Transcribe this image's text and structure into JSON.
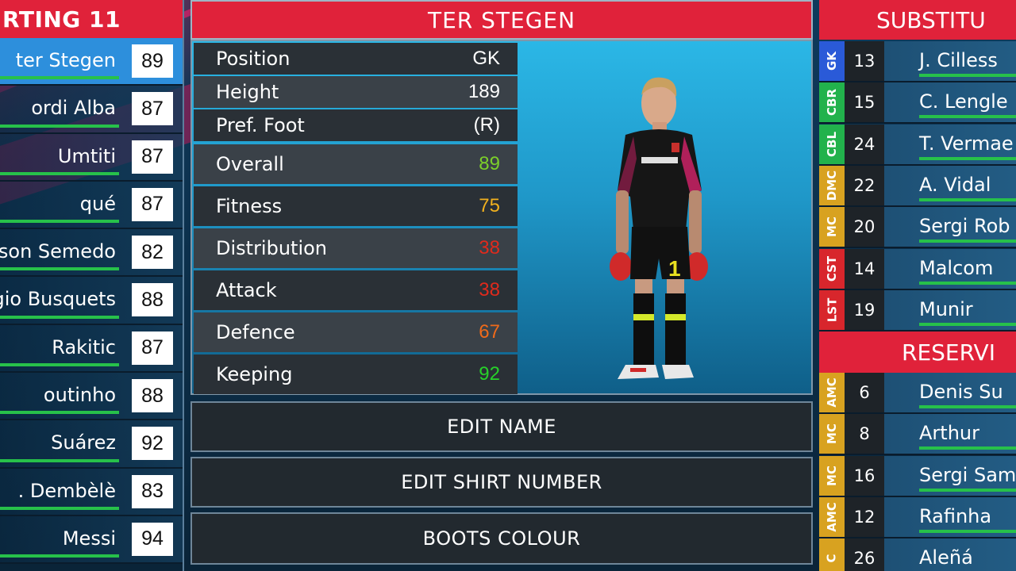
{
  "starting": {
    "title": "RTING 11",
    "players": [
      {
        "name": "ter Stegen",
        "rating": "89"
      },
      {
        "name": "ordi Alba",
        "rating": "87"
      },
      {
        "name": "Umtiti",
        "rating": "87"
      },
      {
        "name": "qué",
        "rating": "87"
      },
      {
        "name": "lson Semedo",
        "rating": "82"
      },
      {
        "name": "rgio Busquets",
        "rating": "88"
      },
      {
        "name": "Rakitic",
        "rating": "87"
      },
      {
        "name": "outinho",
        "rating": "88"
      },
      {
        "name": "Suárez",
        "rating": "92"
      },
      {
        "name": ". Dembèlè",
        "rating": "83"
      },
      {
        "name": "Messi",
        "rating": "94"
      }
    ]
  },
  "player": {
    "name": "TER STEGEN",
    "shirt_number": "1",
    "stats": [
      {
        "label": "Position",
        "value": "GK",
        "color": "#ffffff"
      },
      {
        "label": "Height",
        "value": "189",
        "color": "#ffffff"
      },
      {
        "label": "Pref. Foot",
        "value": "(R)",
        "color": "#ffffff"
      },
      {
        "label": "Overall",
        "value": "89",
        "color": "#7ccf2a"
      },
      {
        "label": "Fitness",
        "value": "75",
        "color": "#f0b01e"
      },
      {
        "label": "Distribution",
        "value": "38",
        "color": "#e02a1c"
      },
      {
        "label": "Attack",
        "value": "38",
        "color": "#e02a1c"
      },
      {
        "label": "Defence",
        "value": "67",
        "color": "#ef6a1a"
      },
      {
        "label": "Keeping",
        "value": "92",
        "color": "#27d12a"
      }
    ]
  },
  "actions": {
    "edit_name": "EDIT NAME",
    "edit_shirt_number": "EDIT SHIRT NUMBER",
    "boots_colour": "BOOTS COLOUR"
  },
  "substitutes": {
    "title": "SUBSTITU",
    "players": [
      {
        "pos": "GK",
        "pos_color": "#2a5ad8",
        "num": "13",
        "name": "J. Cilless"
      },
      {
        "pos": "CBR",
        "pos_color": "#22b24c",
        "num": "15",
        "name": "C. Lengle"
      },
      {
        "pos": "CBL",
        "pos_color": "#22b24c",
        "num": "24",
        "name": "T. Vermae"
      },
      {
        "pos": "DMC",
        "pos_color": "#d8a220",
        "num": "22",
        "name": "A. Vidal"
      },
      {
        "pos": "MC",
        "pos_color": "#d8a220",
        "num": "20",
        "name": "Sergi Rob"
      },
      {
        "pos": "CST",
        "pos_color": "#d8262c",
        "num": "14",
        "name": "Malcom"
      },
      {
        "pos": "LST",
        "pos_color": "#d8262c",
        "num": "19",
        "name": "Munir"
      }
    ]
  },
  "reserves": {
    "title": "RESERVI",
    "players": [
      {
        "pos": "AMC",
        "pos_color": "#d8a220",
        "num": "6",
        "name": "Denis Su"
      },
      {
        "pos": "MC",
        "pos_color": "#d8a220",
        "num": "8",
        "name": "Arthur"
      },
      {
        "pos": "MC",
        "pos_color": "#d8a220",
        "num": "16",
        "name": "Sergi Sam"
      },
      {
        "pos": "AMC",
        "pos_color": "#d8a220",
        "num": "12",
        "name": "Rafinha"
      },
      {
        "pos": "C",
        "pos_color": "#d8a220",
        "num": "26",
        "name": "Aleñá"
      }
    ]
  }
}
